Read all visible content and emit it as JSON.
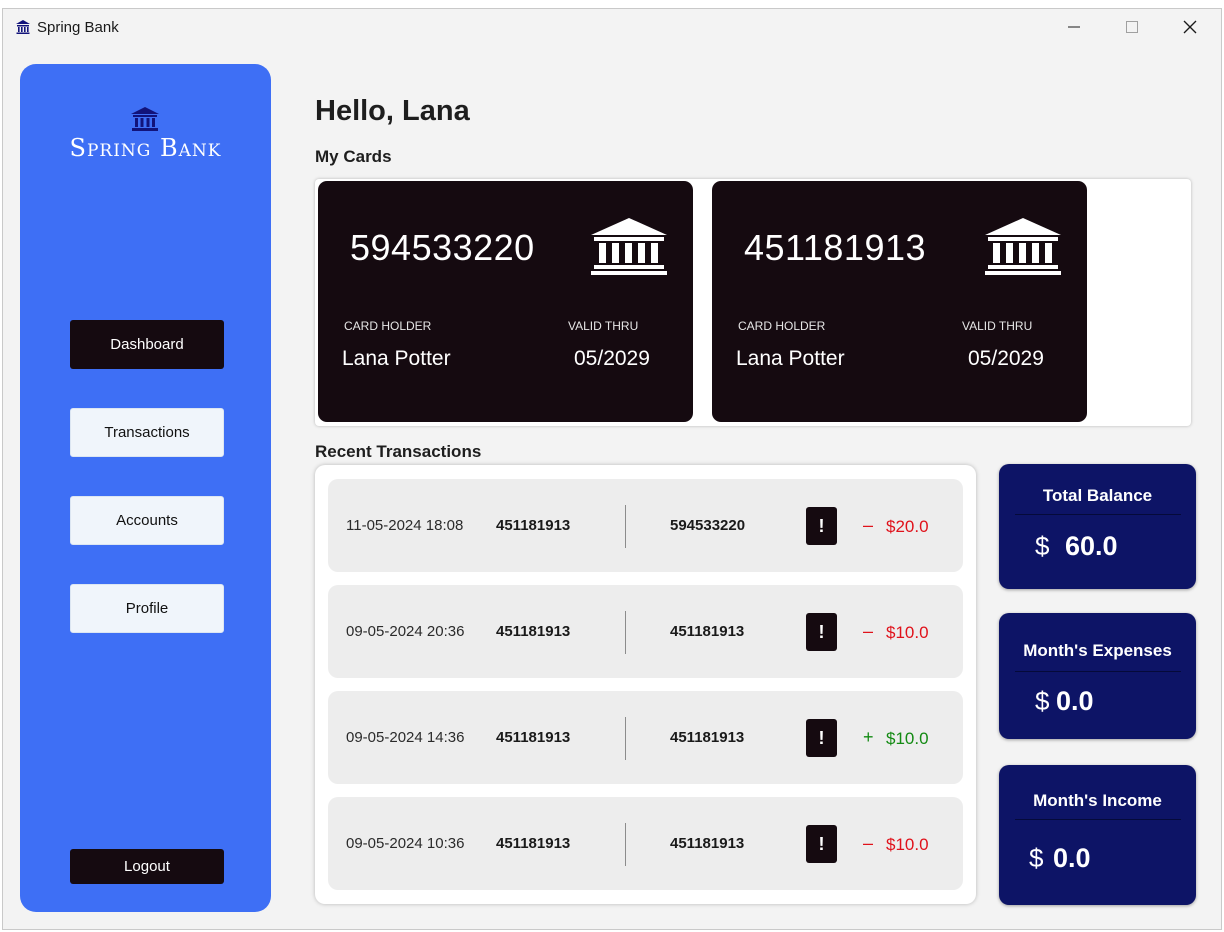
{
  "window": {
    "title": "Spring Bank"
  },
  "sidebar": {
    "logo_text": "Spring Bank",
    "nav": [
      {
        "label": "Dashboard",
        "active": true
      },
      {
        "label": "Transactions",
        "active": false
      },
      {
        "label": "Accounts",
        "active": false
      },
      {
        "label": "Profile",
        "active": false
      }
    ],
    "logout_label": "Logout"
  },
  "main": {
    "greeting": "Hello, Lana",
    "my_cards_title": "My Cards",
    "recent_transactions_title": "Recent Transactions"
  },
  "cards": [
    {
      "number": "594533220",
      "holder_label": "CARD HOLDER",
      "holder": "Lana Potter",
      "valid_label": "VALID THRU",
      "valid": "05/2029"
    },
    {
      "number": "451181913",
      "holder_label": "CARD HOLDER",
      "holder": "Lana Potter",
      "valid_label": "VALID THRU",
      "valid": "05/2029"
    }
  ],
  "transactions": [
    {
      "date": "11-05-2024 18:08",
      "from": "451181913",
      "to": "594533220",
      "alert": "!",
      "sign": "–",
      "amount": "$20.0",
      "type": "debit"
    },
    {
      "date": "09-05-2024 20:36",
      "from": "451181913",
      "to": "451181913",
      "alert": "!",
      "sign": "–",
      "amount": "$10.0",
      "type": "debit"
    },
    {
      "date": "09-05-2024 14:36",
      "from": "451181913",
      "to": "451181913",
      "alert": "!",
      "sign": "+",
      "amount": "$10.0",
      "type": "credit"
    },
    {
      "date": "09-05-2024 10:36",
      "from": "451181913",
      "to": "451181913",
      "alert": "!",
      "sign": "–",
      "amount": "$10.0",
      "type": "debit"
    }
  ],
  "stats": {
    "total_balance": {
      "title": "Total Balance",
      "currency": "$",
      "value": "60.0"
    },
    "month_expenses": {
      "title": "Month's Expenses",
      "currency": "$",
      "value": "0.0"
    },
    "month_income": {
      "title": "Month's Income",
      "currency": "$",
      "value": "0.0"
    }
  },
  "colors": {
    "sidebar_bg": "#3e6ff5",
    "card_bg": "#150a10",
    "stat_bg": "#0d1466",
    "debit": "#e0121b",
    "credit": "#138a13"
  }
}
